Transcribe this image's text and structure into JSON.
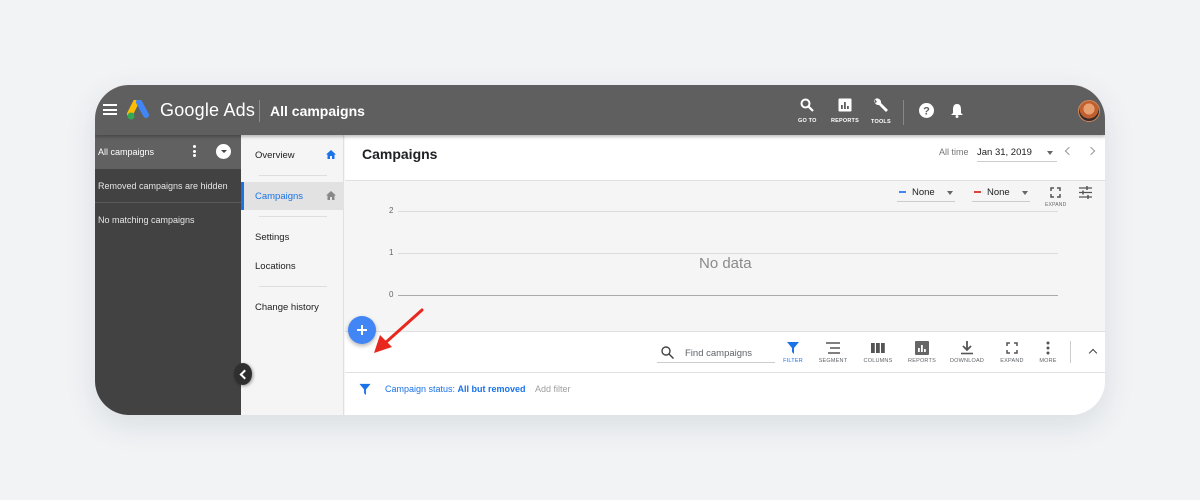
{
  "topbar": {
    "brand": "Google Ads",
    "page_title": "All campaigns",
    "actions": [
      {
        "icon": "search-icon",
        "label": "GO TO"
      },
      {
        "icon": "reports-icon",
        "label": "REPORTS"
      },
      {
        "icon": "wrench-icon",
        "label": "TOOLS"
      }
    ],
    "help_icon": "help-icon",
    "notifications_icon": "bell-icon"
  },
  "left_panel": {
    "header": "All campaigns",
    "rows": [
      "Removed campaigns are hidden",
      "No matching campaigns"
    ]
  },
  "nav": {
    "items": [
      {
        "label": "Overview",
        "icon": "home-icon",
        "active": false
      },
      {
        "label": "Campaigns",
        "icon": "home-icon",
        "active": true
      },
      {
        "label": "Settings"
      },
      {
        "label": "Locations"
      },
      {
        "label": "Change history"
      }
    ]
  },
  "main": {
    "title": "Campaigns",
    "date_range_label": "All time",
    "date_value": "Jan 31, 2019"
  },
  "chart": {
    "metric_1": {
      "label": "None",
      "color": "#4285f4"
    },
    "metric_2": {
      "label": "None",
      "color": "#db4437"
    },
    "expand_label": "EXPAND",
    "empty_message": "No data",
    "y_ticks": [
      "2",
      "1",
      "0"
    ]
  },
  "toolbar": {
    "search_placeholder": "Find campaigns",
    "tools": [
      {
        "icon": "filter-icon",
        "label": "FILTER",
        "active": true
      },
      {
        "icon": "segment-icon",
        "label": "SEGMENT"
      },
      {
        "icon": "columns-icon",
        "label": "COLUMNS"
      },
      {
        "icon": "reports-icon",
        "label": "REPORTS"
      },
      {
        "icon": "download-icon",
        "label": "DOWNLOAD"
      },
      {
        "icon": "expand-icon",
        "label": "EXPAND"
      },
      {
        "icon": "more-icon",
        "label": "MORE"
      }
    ]
  },
  "filter": {
    "prefix": "Campaign status: ",
    "value": "All but removed",
    "add_label": "Add filter"
  },
  "colors": {
    "topbar": "#5f5f5f",
    "accent": "#1a73e8",
    "fab": "#4285f4",
    "annotation_arrow": "#e8281e"
  }
}
